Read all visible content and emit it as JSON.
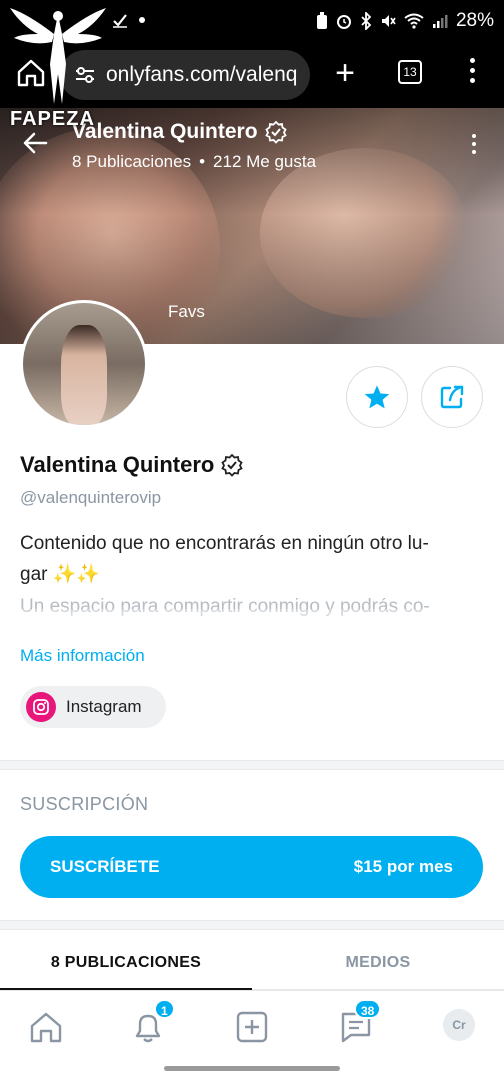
{
  "status_bar": {
    "battery": "28%",
    "icons": [
      "image-icon",
      "check-icon",
      "dot-icon",
      "battery-saver-icon",
      "alarm-icon",
      "bluetooth-icon",
      "mute-icon",
      "wifi-icon",
      "signal-icon"
    ]
  },
  "browser": {
    "url": "onlyfans.com/valenq",
    "tab_count": "13"
  },
  "watermark": {
    "text": "FAPEZA"
  },
  "cover": {
    "name": "Valentina Quintero",
    "posts": "8 Publicaciones",
    "likes": "212 Me gusta",
    "separator": "•",
    "favs": "Favs"
  },
  "profile": {
    "name": "Valentina Quintero",
    "handle": "@valenquinterovip",
    "bio_line1": "Contenido que no encontrarás en ningún otro lu-",
    "bio_line2": "gar ✨✨",
    "bio_line3": "Un espacio para compartir conmigo y podrás co-",
    "more_info": "Más información",
    "social": {
      "label": "Instagram"
    }
  },
  "subscription": {
    "title": "SUSCRIPCIÓN",
    "button_label": "SUSCRÍBETE",
    "price": "$15 por mes"
  },
  "tabs": [
    {
      "label": "8 PUBLICACIONES",
      "active": true
    },
    {
      "label": "MEDIOS",
      "active": false
    }
  ],
  "bottom_nav": {
    "notifications_badge": "1",
    "messages_badge": "38",
    "avatar_initials": "Cr"
  },
  "colors": {
    "accent": "#00aff0",
    "instagram": "#e8157a",
    "muted": "#8a96a3"
  }
}
